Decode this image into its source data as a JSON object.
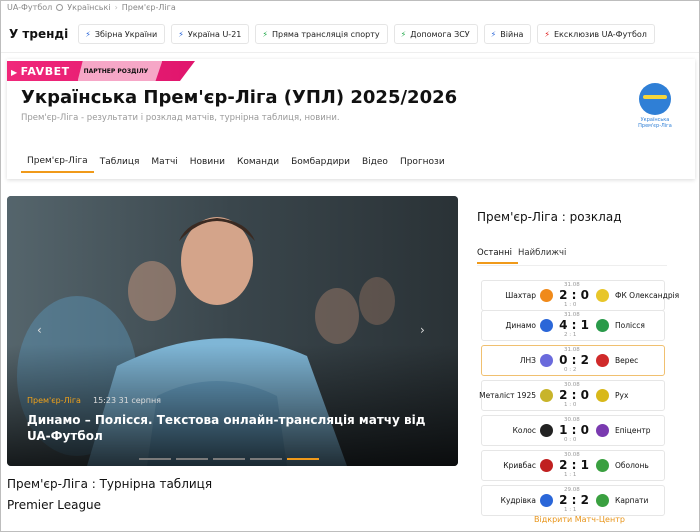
{
  "breadcrumbs": [
    "UA-Футбол",
    "Українські",
    "Прем'єр-Ліга"
  ],
  "trends": {
    "title": "У тренді",
    "items": [
      "Збірна України",
      "Україна U-21",
      "Пряма трансляція спорту",
      "Допомога ЗСУ",
      "Війна",
      "Ексклюзив UA-Футбол"
    ],
    "bolt_colors": [
      "#2a66d8",
      "#2a66d8",
      "#22a84a",
      "#22a84a",
      "#2a66d8",
      "#e02020"
    ]
  },
  "sponsor": {
    "logo": "FAVBET",
    "partner": "ПАРТНЕР РОЗДІЛУ"
  },
  "league": {
    "title": "Українська Прем'єр-Ліга (УПЛ) 2025/2026",
    "description": "Прем'єр-Ліга - результати і розклад матчів, турнірна таблиця, новини.",
    "logo_text": [
      "Українська",
      "Прем'єр-Ліга"
    ]
  },
  "tabs": [
    "Прем'єр-Ліга",
    "Таблиця",
    "Матчі",
    "Новини",
    "Команди",
    "Бомбардири",
    "Відео",
    "Прогнози"
  ],
  "hero": {
    "category": "Прем'єр-Ліга",
    "time": "15:23 31 серпня",
    "headline": "Динамо – Полісся. Текстова онлайн-трансляція матчу від UA-Футбол",
    "prev": "‹",
    "next": "›"
  },
  "table_title": "Прем'єр-Ліга : Турнірна таблиця",
  "table_sub": "Premier League",
  "schedule": {
    "title": "Прем'єр-Ліга : розклад",
    "tabs": [
      "Останні",
      "Найближчі"
    ],
    "matches": [
      {
        "home": "Шахтар",
        "away": "ФК Олександрія",
        "date": "31.08",
        "score": "2 : 0",
        "ht": "1 : 0",
        "home_color": "#f08a1a",
        "away_color": "#e8c62a"
      },
      {
        "home": "Динамо",
        "away": "Полісся",
        "date": "31.08",
        "score": "4 : 1",
        "ht": "2 : 1",
        "home_color": "#2a66d8",
        "away_color": "#2a9a4a"
      },
      {
        "home": "ЛНЗ",
        "away": "Верес",
        "date": "31.08",
        "score": "0 : 2",
        "ht": "0 : 2",
        "home_color": "#6a6adc",
        "away_color": "#d02a2a"
      },
      {
        "home": "Металіст 1925",
        "away": "Рух",
        "date": "30.08",
        "score": "2 : 0",
        "ht": "1 : 0",
        "home_color": "#c8b42a",
        "away_color": "#d8b81a"
      },
      {
        "home": "Колос",
        "away": "Епіцентр",
        "date": "30.08",
        "score": "1 : 0",
        "ht": "0 : 0",
        "home_color": "#222222",
        "away_color": "#7a3ab0"
      },
      {
        "home": "Кривбас",
        "away": "Оболонь",
        "date": "30.08",
        "score": "2 : 1",
        "ht": "1 : 1",
        "home_color": "#c02020",
        "away_color": "#3aa040"
      },
      {
        "home": "Кудрівка",
        "away": "Карпати",
        "date": "29.08",
        "score": "2 : 2",
        "ht": "1 : 1",
        "home_color": "#2a66d8",
        "away_color": "#3aa040"
      }
    ],
    "open_center": "Відкрити Матч-Центр"
  }
}
